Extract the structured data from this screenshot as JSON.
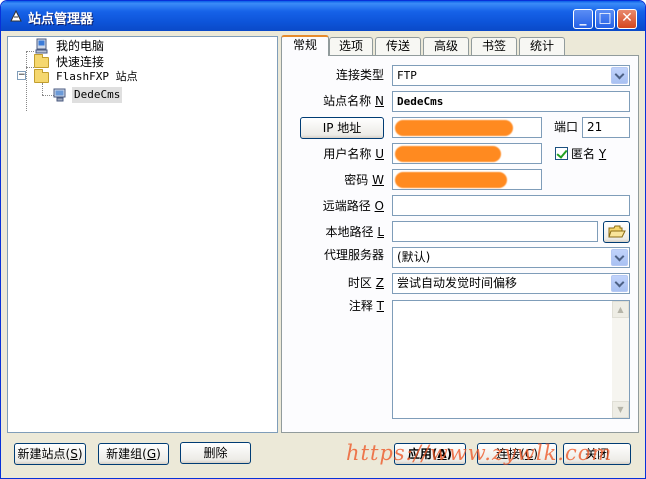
{
  "window": {
    "title": "站点管理器",
    "minimize_glyph": "_",
    "maximize_glyph": "□",
    "close_glyph": "✕"
  },
  "tree": {
    "items": [
      {
        "label": "我的电脑",
        "icon": "computer-icon"
      },
      {
        "label": "快速连接",
        "icon": "folder-icon"
      },
      {
        "label": "FlashFXP 站点",
        "icon": "folder-icon",
        "expander": "−"
      },
      {
        "label": "DedeCms",
        "icon": "server-icon",
        "selected": true
      }
    ]
  },
  "tabs": [
    {
      "label": "常规",
      "active": true
    },
    {
      "label": "选项"
    },
    {
      "label": "传送"
    },
    {
      "label": "高级"
    },
    {
      "label": "书签"
    },
    {
      "label": "统计"
    }
  ],
  "form": {
    "conn_type_label": "连接类型",
    "conn_type_value": "FTP",
    "site_name_label": "站点名称",
    "site_name_key": "N",
    "site_name_value": "DedeCms",
    "ip_button": "IP 地址",
    "port_label": "端口",
    "port_value": "21",
    "user_label": "用户名称",
    "user_key": "U",
    "anon_label": "匿名",
    "anon_key": "Y",
    "anon_checked": true,
    "pass_label": "密码",
    "pass_key": "W",
    "remote_label": "远端路径",
    "remote_key": "O",
    "remote_value": "",
    "local_label": "本地路径",
    "local_key": "L",
    "local_value": "",
    "proxy_label": "代理服务器",
    "proxy_value": "(默认)",
    "tz_label": "时区",
    "tz_key": "Z",
    "tz_value": "尝试自动发觉时间偏移",
    "notes_label": "注释",
    "notes_key": "T"
  },
  "bottom": {
    "new_site": "新建站点",
    "new_site_key": "S",
    "new_group": "新建组",
    "new_group_key": "G",
    "delete": "删除",
    "apply": "应用",
    "apply_key": "A",
    "connect": "连接",
    "connect_key": "C",
    "close": "关闭"
  },
  "watermark": "https://www.zywlk.com",
  "colors": {
    "redaction": "#ff8a20",
    "title_bar": "#0d54d9"
  }
}
